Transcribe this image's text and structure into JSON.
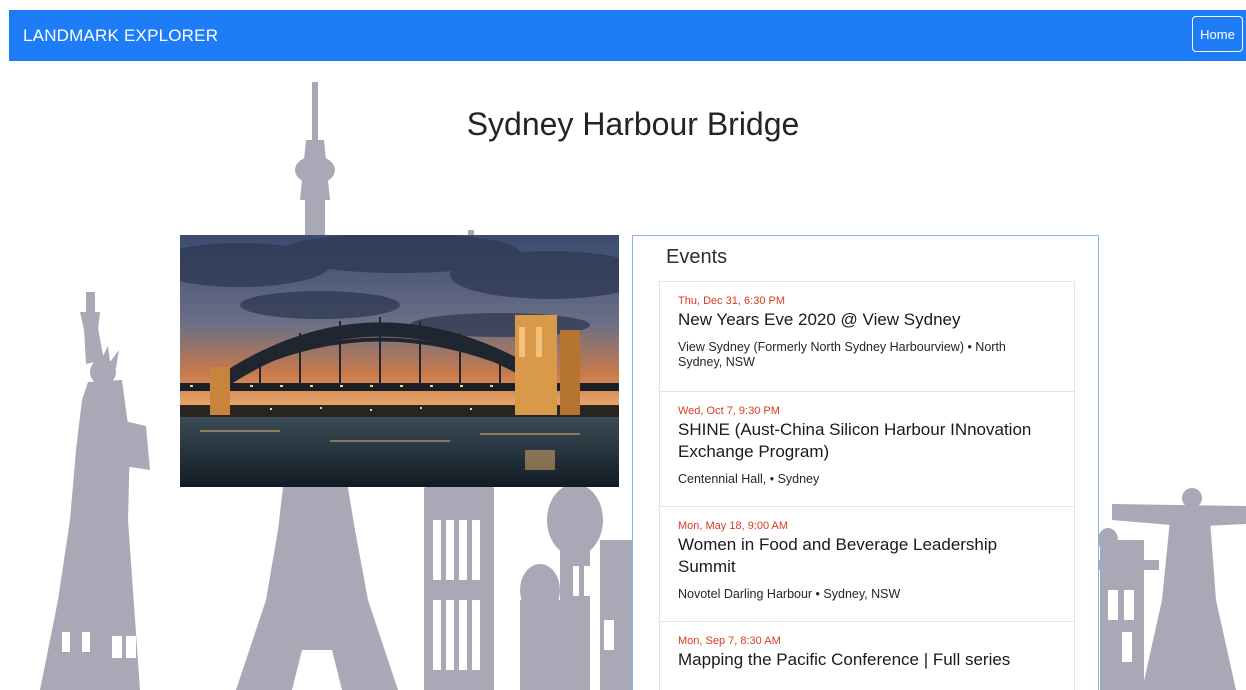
{
  "navbar": {
    "brand": "LANDMARK EXPLORER",
    "home_label": "Home",
    "color": "#1e7cf6"
  },
  "landmark": {
    "title": "Sydney Harbour Bridge",
    "photo_subject": "sydney-harbour-bridge-at-dusk"
  },
  "events": {
    "heading": "Events",
    "items": [
      {
        "date": "Thu, Dec 31, 6:30 PM",
        "title": "New Years Eve 2020 @ View Sydney",
        "venue": "View Sydney (Formerly North Sydney Harbourview) • North Sydney, NSW"
      },
      {
        "date": "Wed, Oct 7, 9:30 PM",
        "title": "SHINE (Aust-China Silicon Harbour INnovation Exchange Program)",
        "venue": "Centennial Hall, • Sydney"
      },
      {
        "date": "Mon, May 18, 9:00 AM",
        "title": "Women in Food and Beverage Leadership Summit",
        "venue": "Novotel Darling Harbour • Sydney, NSW"
      },
      {
        "date": "Mon, Sep 7, 8:30 AM",
        "title": "Mapping the Pacific Conference | Full series",
        "venue": ""
      }
    ]
  },
  "colors": {
    "date_accent": "#d93a1e",
    "skyline": "#a9a8b6",
    "panel_border": "#8ab4f0"
  }
}
